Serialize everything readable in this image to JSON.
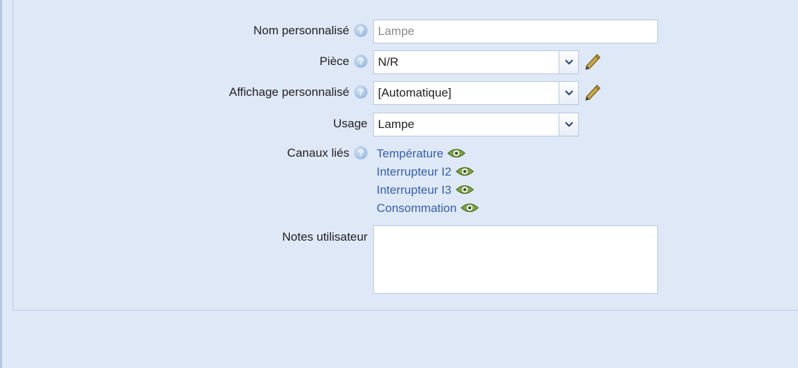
{
  "form": {
    "custom_name": {
      "label": "Nom personnalisé",
      "placeholder": "Lampe",
      "value": ""
    },
    "room": {
      "label": "Pièce",
      "selected": "N/R"
    },
    "custom_display": {
      "label": "Affichage personnalisé",
      "selected": "[Automatique]"
    },
    "usage": {
      "label": "Usage",
      "selected": "Lampe"
    },
    "linked_channels": {
      "label": "Canaux liés",
      "items": [
        {
          "label": "Température",
          "icon": "eye-icon"
        },
        {
          "label": "Interrupteur I2",
          "icon": "eye-icon"
        },
        {
          "label": "Interrupteur I3",
          "icon": "eye-icon"
        },
        {
          "label": "Consommation",
          "icon": "eye-icon"
        }
      ]
    },
    "user_notes": {
      "label": "Notes utilisateur",
      "value": ""
    },
    "help_glyph": "?"
  },
  "colors": {
    "background": "#dfe8f6",
    "link": "#3560a8",
    "eye_icon": "#6b8f3a",
    "border": "#b5c7df"
  }
}
